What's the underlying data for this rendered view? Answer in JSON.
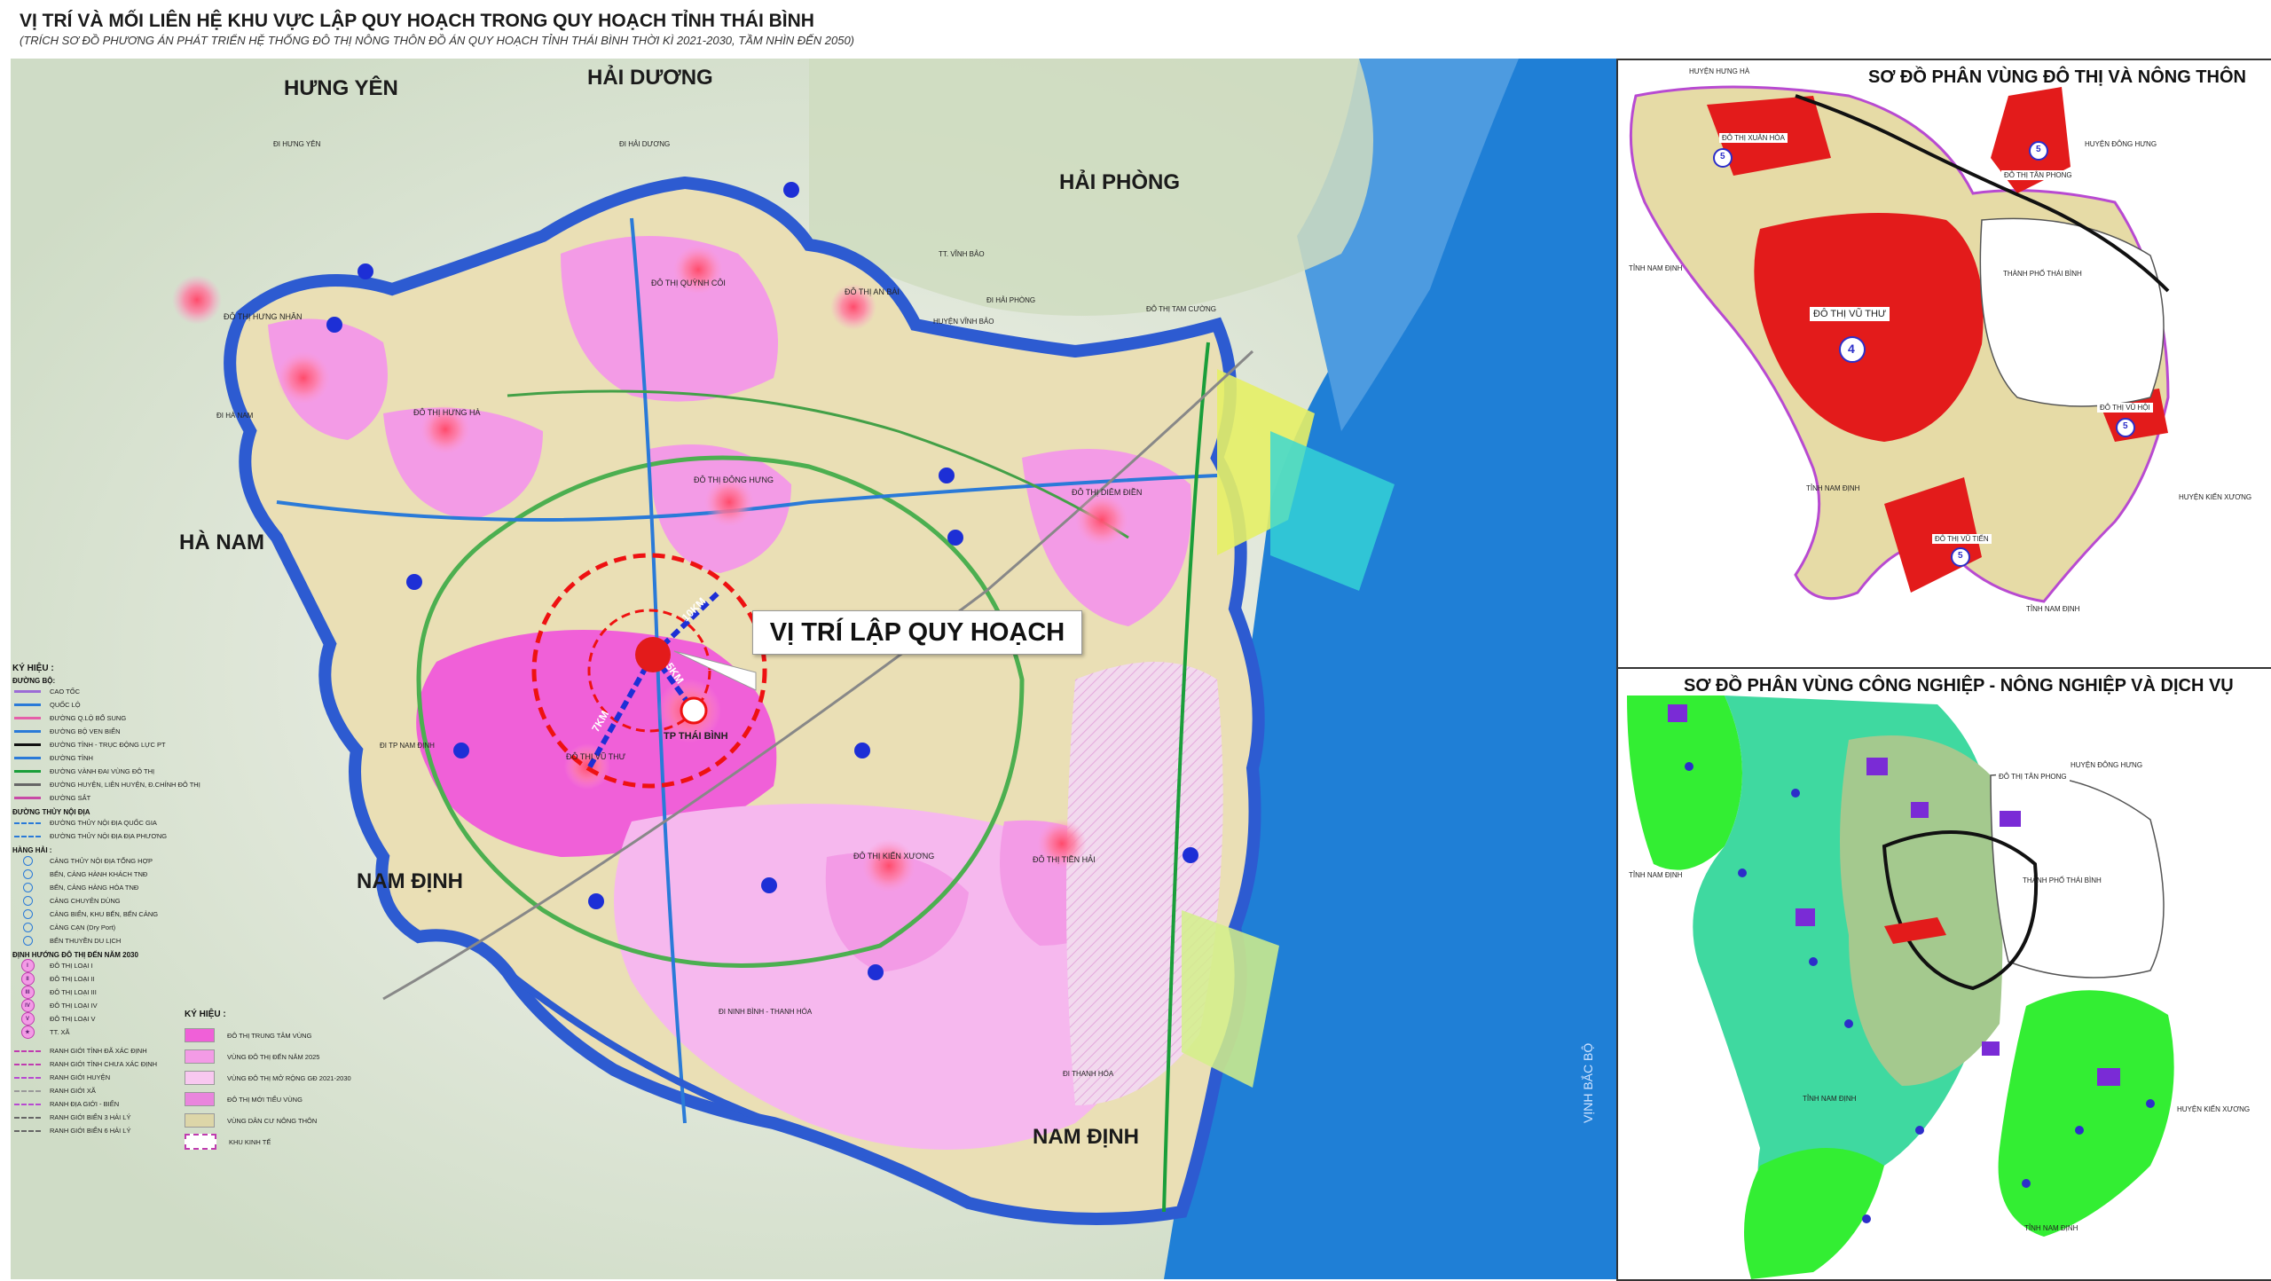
{
  "header": {
    "title": "VỊ TRÍ VÀ MỐI LIÊN HỆ KHU VỰC LẬP QUY HOẠCH TRONG QUY HOẠCH TỈNH THÁI BÌNH",
    "subtitle": "(TRÍCH SƠ ĐỒ PHƯƠNG ÁN PHÁT TRIỂN HỆ THỐNG ĐÔ THỊ NÔNG THÔN ĐỒ ÁN QUY HOẠCH TỈNH THÁI BÌNH THỜI KÌ 2021-2030, TẦM NHÌN ĐẾN 2050)"
  },
  "main_map": {
    "provinces": {
      "hung_yen": "HƯNG YÊN",
      "hai_duong": "HẢI DƯƠNG",
      "hai_phong": "HẢI PHÒNG",
      "ha_nam": "HÀ NAM",
      "nam_dinh_w": "NAM ĐỊNH",
      "nam_dinh_s": "NAM ĐỊNH"
    },
    "callout": "VỊ TRÍ LẬP QUY HOẠCH",
    "tp_thai_binh": "TP THÁI BÌNH",
    "dist_7km": "7KM",
    "dist_5km": "5KM",
    "dist_10km": "10KM",
    "places": {
      "hung_nhan": "ĐÔ THỊ HƯNG NHÂN",
      "hung_ha": "ĐÔ THỊ HƯNG HÀ",
      "quynh_coi": "ĐÔ THỊ QUỲNH CÔI",
      "an_bai": "ĐÔ THỊ AN BÀI",
      "dong_hung": "ĐÔ THỊ ĐÔNG HƯNG",
      "diem_dien": "ĐÔ THỊ DIÊM ĐIỀN",
      "vu_thu": "ĐÔ THỊ VŨ THƯ",
      "kien_xuong": "ĐÔ THỊ KIẾN XƯƠNG",
      "tien_hai": "ĐÔ THỊ TIỀN HẢI",
      "di_hung_yen": "ĐI HƯNG YÊN",
      "di_hai_duong": "ĐI HẢI DƯƠNG",
      "di_hai_phong": "ĐI HẢI PHÒNG",
      "di_ha_nam": "ĐI HÀ NAM",
      "di_tp_nam_dinh": "ĐI TP NAM ĐỊNH",
      "di_ninh_binh": "ĐI NINH BÌNH - THANH HÓA",
      "di_thanh_hoa": "ĐI THANH HÓA",
      "vinh_bao": "HUYỆN VĨNH BẢO",
      "tt_vinh_bao": "TT. VĨNH BẢO",
      "tam_cuong": "ĐÔ THỊ TAM CƯỜNG",
      "vinh_bac_bo": "VỊNH BẮC BỘ"
    },
    "legend_left": {
      "title": "KÝ HIỆU :",
      "roads_head": "ĐƯỜNG BỘ:",
      "roads": [
        "CAO TỐC",
        "QUỐC LỘ",
        "ĐƯỜNG Q.LỘ BỔ SUNG",
        "ĐƯỜNG BỘ VEN BIỂN",
        "ĐƯỜNG TỈNH - TRỤC ĐỘNG LỰC PT",
        "ĐƯỜNG TỈNH",
        "ĐƯỜNG VÀNH ĐAI VÙNG ĐÔ THỊ",
        "ĐƯỜNG HUYỆN, LIÊN HUYỆN, Đ.CHÍNH ĐÔ THỊ",
        "ĐƯỜNG SẮT"
      ],
      "water_head": "ĐƯỜNG THỦY NỘI ĐỊA",
      "water": [
        "ĐƯỜNG THỦY NỘI ĐỊA QUỐC GIA",
        "ĐƯỜNG THỦY NỘI ĐỊA ĐỊA PHƯƠNG"
      ],
      "ports_head": "HÀNG HẢI :",
      "ports": [
        "CẢNG THỦY NỘI ĐỊA TỔNG HỢP",
        "BẾN, CẢNG HÀNH KHÁCH TNĐ",
        "BẾN, CẢNG HÀNG HÓA TNĐ",
        "CẢNG CHUYÊN DÙNG",
        "CẢNG BIỂN, KHU BẾN, BẾN CẢNG",
        "CẢNG CẠN (Dry Port)",
        "BẾN THUYỀN DU LỊCH"
      ],
      "urban_head": "ĐỊNH HƯỚNG ĐÔ THỊ ĐẾN NĂM 2030",
      "urban": [
        {
          "sym": "I",
          "label": "ĐÔ THỊ LOẠI I"
        },
        {
          "sym": "II",
          "label": "ĐÔ THỊ LOẠI II"
        },
        {
          "sym": "III",
          "label": "ĐÔ THỊ LOẠI III"
        },
        {
          "sym": "IV",
          "label": "ĐÔ THỊ LOẠI IV"
        },
        {
          "sym": "V",
          "label": "ĐÔ THỊ LOẠI V"
        },
        {
          "sym": "★",
          "label": "TT. XÃ"
        }
      ],
      "bounds": [
        "RANH GIỚI TỈNH ĐÃ XÁC ĐỊNH",
        "RANH GIỚI TỈNH CHƯA XÁC ĐỊNH",
        "RANH GIỚI HUYỆN",
        "RANH GIỚI XÃ",
        "RANH ĐỊA GIỚI - BIỂN",
        "RANH GIỚI BIỂN 3 HẢI LÝ",
        "RANH GIỚI BIỂN 6 HẢI LÝ"
      ]
    },
    "legend_mid": {
      "title": "KÝ HIỆU :",
      "items": [
        {
          "label": "ĐÔ THỊ TRUNG TÂM VÙNG",
          "color": "#f060d8"
        },
        {
          "label": "VÙNG ĐÔ THỊ ĐẾN NĂM 2025",
          "color": "#f39be6"
        },
        {
          "label": "VÙNG ĐÔ THỊ MỞ RỘNG GĐ 2021-2030",
          "color": "#f8c8f0"
        },
        {
          "label": "ĐÔ THỊ MỚI TIỂU VÙNG",
          "color": "#e985dd"
        },
        {
          "label": "VÙNG DÂN CƯ NÔNG THÔN",
          "color": "#ddd6a8"
        },
        {
          "label": "KHU KINH TẾ",
          "color": "#ffffff"
        }
      ]
    }
  },
  "inset1": {
    "title": "SƠ ĐỒ PHÂN VÙNG ĐÔ THỊ VÀ NÔNG THÔN",
    "labels": {
      "hung_ha": "HUYỆN HƯNG HÀ",
      "xuan_hoa": "ĐÔ THỊ XUÂN HÒA",
      "tan_phong": "ĐÔ THỊ TÂN PHONG",
      "dong_hung": "HUYỆN ĐÔNG HƯNG",
      "tp_thai_binh": "THÀNH PHỐ THÁI BÌNH",
      "nam_dinh_1": "TỈNH NAM ĐỊNH",
      "vu_thu": "ĐÔ THỊ VŨ THƯ",
      "vu_hoi": "ĐÔ THỊ VŨ HỘI",
      "nam_dinh_2": "TỈNH NAM ĐỊNH",
      "kien_xuong": "HUYỆN KIẾN XƯƠNG",
      "vu_tien": "ĐÔ THỊ VŨ TIẾN",
      "nam_dinh_3": "TỈNH NAM ĐỊNH"
    },
    "badges": {
      "xuan_hoa": "5",
      "tan_phong": "5",
      "vu_thu": "4",
      "vu_hoi": "5",
      "vu_tien": "5"
    }
  },
  "inset2": {
    "title": "SƠ ĐỒ PHÂN VÙNG CÔNG NGHIỆP - NÔNG NGHIỆP VÀ DỊCH VỤ",
    "labels": {
      "tan_phong": "ĐÔ THỊ TÂN PHONG",
      "dong_hung": "HUYỆN ĐÔNG HƯNG",
      "nam_dinh_1": "TỈNH NAM ĐỊNH",
      "tp_thai_binh": "THÀNH PHỐ THÁI BÌNH",
      "nam_dinh_2": "TỈNH NAM ĐỊNH",
      "kien_xuong": "HUYỆN KIẾN XƯƠNG",
      "nam_dinh_3": "TỈNH NAM ĐỊNH"
    }
  },
  "colors": {
    "pink": "#f060d8",
    "light_pink": "#f6b8ee",
    "beige": "#eadfb5",
    "river": "#3366cc",
    "sea": "#1f7fd6",
    "red": "#e31b1b",
    "green": "#33ee33"
  }
}
